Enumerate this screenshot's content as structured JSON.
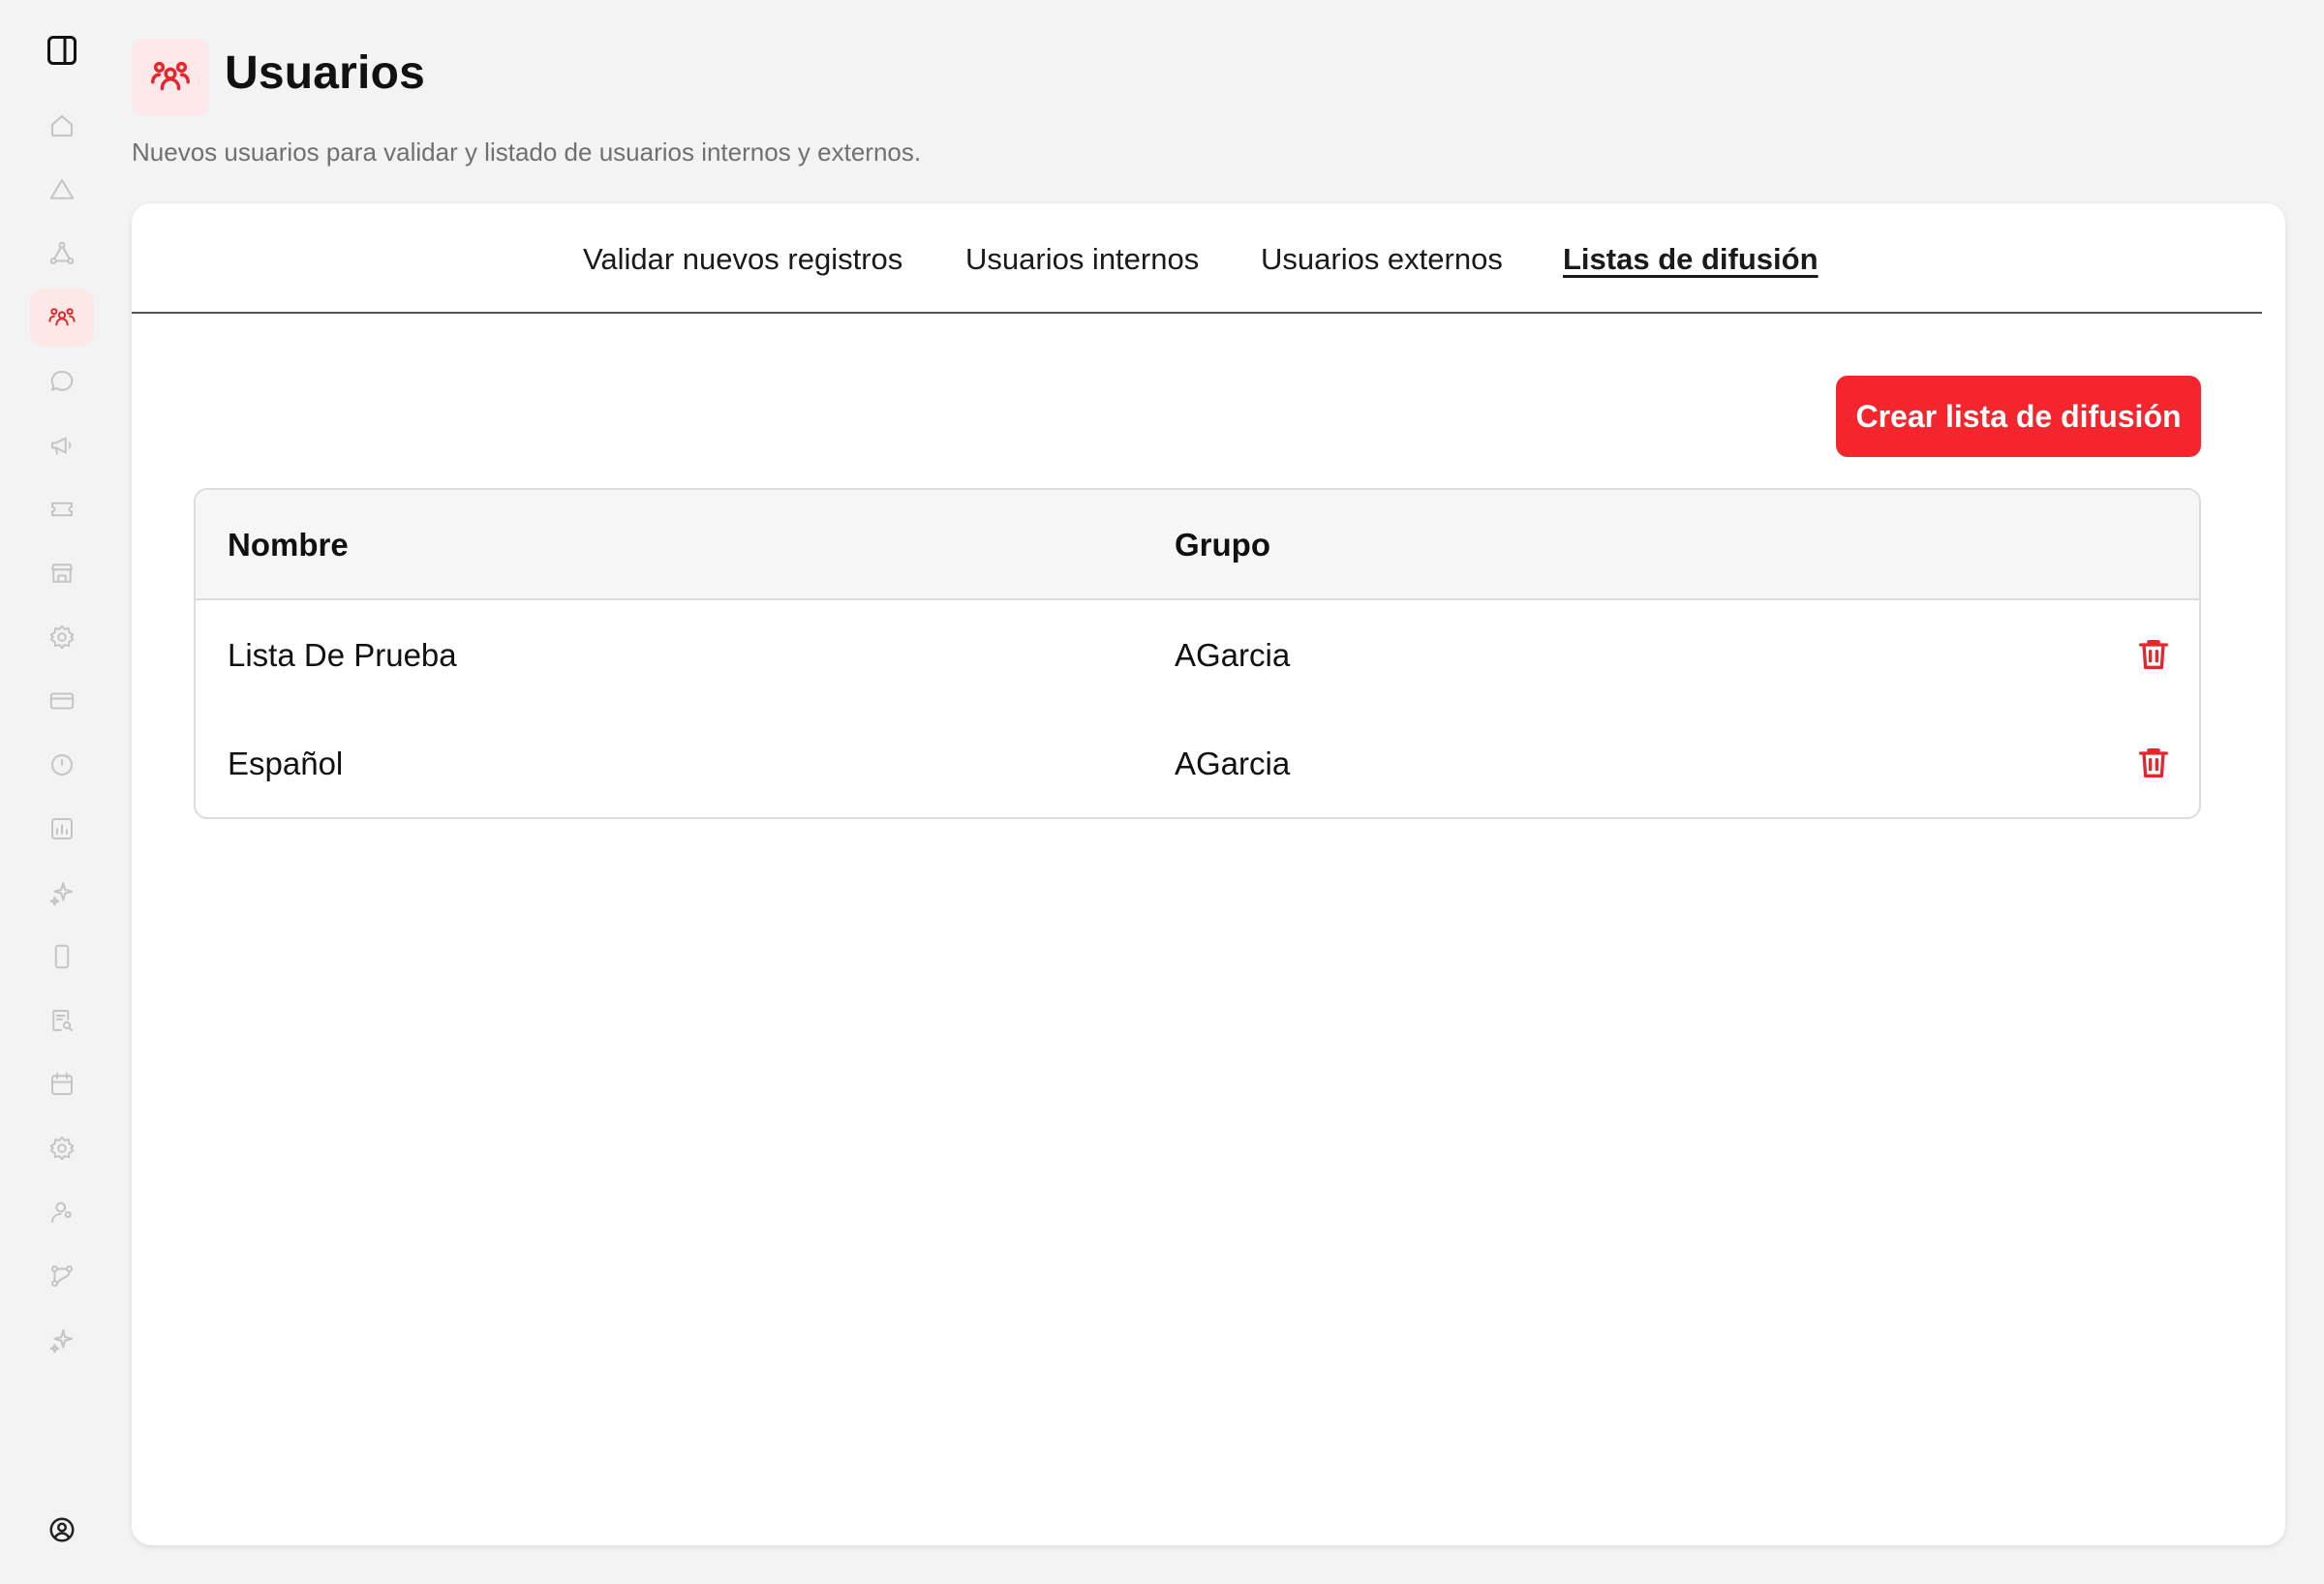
{
  "header": {
    "title": "Usuarios",
    "subtitle": "Nuevos usuarios para validar y listado de usuarios internos y externos.",
    "icon": "users-icon"
  },
  "sidebar": {
    "items": [
      {
        "icon": "sidebar-toggle-icon"
      },
      {
        "icon": "home-icon"
      },
      {
        "icon": "alert-triangle-icon"
      },
      {
        "icon": "shapes-icon"
      },
      {
        "icon": "users-icon",
        "active": true
      },
      {
        "icon": "chat-icon"
      },
      {
        "icon": "megaphone-icon"
      },
      {
        "icon": "ticket-icon"
      },
      {
        "icon": "store-icon"
      },
      {
        "icon": "gear-icon"
      },
      {
        "icon": "card-icon"
      },
      {
        "icon": "clock-icon"
      },
      {
        "icon": "chart-icon"
      },
      {
        "icon": "sparkle-icon"
      },
      {
        "icon": "phone-icon"
      },
      {
        "icon": "document-search-icon"
      },
      {
        "icon": "calendar-icon"
      },
      {
        "icon": "settings-icon"
      },
      {
        "icon": "user-icon"
      },
      {
        "icon": "flow-icon"
      },
      {
        "icon": "sparkle-icon"
      },
      {
        "icon": "profile-icon"
      }
    ]
  },
  "tabs": [
    {
      "label": "Validar nuevos registros"
    },
    {
      "label": "Usuarios internos"
    },
    {
      "label": "Usuarios externos"
    },
    {
      "label": "Listas de difusión",
      "active": true
    }
  ],
  "actions": {
    "create_label": "Crear lista de difusión"
  },
  "table": {
    "columns": [
      "Nombre",
      "Grupo"
    ],
    "rows": [
      {
        "nombre": "Lista De Prueba",
        "grupo": "AGarcia"
      },
      {
        "nombre": "Español",
        "grupo": "AGarcia"
      }
    ]
  },
  "colors": {
    "accent": "#f5252d",
    "accent_soft": "#fde8e8",
    "background": "#f3f3f3"
  }
}
